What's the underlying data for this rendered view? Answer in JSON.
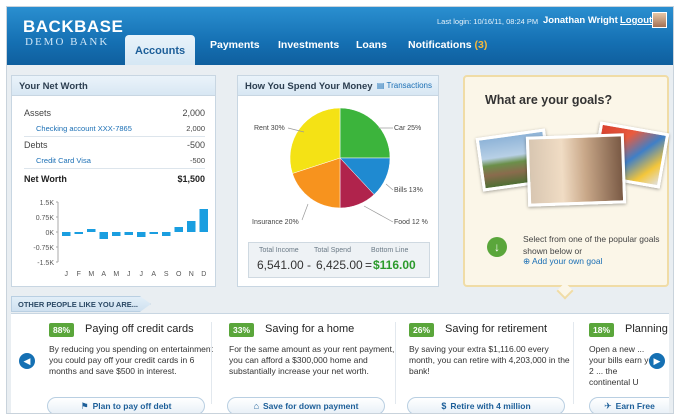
{
  "header": {
    "logo_title": "BACKBASE",
    "logo_subtitle": "DEMO BANK",
    "last_login": "Last login: 10/16/11, 08:24 PM",
    "user_name": "Jonathan Wright",
    "logout": "Logout",
    "tabs": [
      {
        "label": "Accounts",
        "active": true
      },
      {
        "label": "Payments"
      },
      {
        "label": "Investments"
      },
      {
        "label": "Loans"
      },
      {
        "label": "Notifications",
        "count": "(3)"
      }
    ]
  },
  "net_worth": {
    "title": "Your Net Worth",
    "assets_label": "Assets",
    "assets_value": "2,000",
    "checking_label": "Checking account XXX-7865",
    "checking_value": "2,000",
    "debts_label": "Debts",
    "debts_value": "-500",
    "card_label": "Credit Card Visa",
    "card_value": "-500",
    "total_label": "Net Worth",
    "total_value": "$1,500",
    "chart": {
      "y_ticks": [
        "1.5K",
        "0.75K",
        "0K",
        "-0.75K",
        "-1.5K"
      ],
      "months": [
        "J",
        "F",
        "M",
        "A",
        "M",
        "J",
        "J",
        "A",
        "S",
        "O",
        "N",
        "D"
      ],
      "values": [
        -0.2,
        -0.1,
        0.15,
        -0.35,
        -0.2,
        -0.15,
        -0.25,
        -0.1,
        -0.2,
        0.25,
        0.55,
        1.15
      ],
      "bar_color": "#1a9ee0"
    }
  },
  "spend": {
    "title": "How You Spend Your Money",
    "link": "Transactions",
    "slices": [
      {
        "label": "Rent 30%",
        "value": 30,
        "color": "#3cb43c"
      },
      {
        "label": "Car 25%",
        "value": 25,
        "color": "#3cb43c"
      },
      {
        "label": "Bills 13%",
        "value": 13,
        "color": "#1f8ad1"
      },
      {
        "label": "Food 12 %",
        "value": 12,
        "color": "#b0234c"
      },
      {
        "label": "Insurance 20%",
        "value": 20,
        "color": "#f7931e"
      }
    ],
    "pie_colors": {
      "rent": "#f4e215",
      "car": "#3cb43c",
      "bills": "#1f8ad1",
      "food": "#b0234c",
      "insurance": "#f7931e"
    },
    "total_income_label": "Total Income",
    "total_spend_label": "Total Spend",
    "bottom_line_label": "Bottom Line",
    "total_income": "6,541.00",
    "minus": "-",
    "total_spend": "6,425.00",
    "equals": "=",
    "bottom_line": "$116.00"
  },
  "goals": {
    "title": "What are your goals?",
    "description": "Select from one of the popular goals shown below or",
    "add_link": "Add your own goal"
  },
  "others": {
    "label": "OTHER PEOPLE LIKE YOU ARE...",
    "cards": [
      {
        "badge": "88%",
        "title": "Paying off credit cards",
        "text": "By reducing you spending on entertainment you could pay off your credit cards in 6 months and save $500 in interest.",
        "button": "Plan to pay off debt",
        "icon": "⚑"
      },
      {
        "badge": "33%",
        "title": "Saving for a home",
        "text": "For the same amount as your rent payment, you can afford a $300,000 home and substantially increase your net worth.",
        "button": "Save for down payment",
        "icon": "⌂"
      },
      {
        "badge": "26%",
        "title": "Saving for retirement",
        "text": "By saving your extra $1,116.00 every month, you can retire with 4,203,000 in the bank!",
        "button": "Retire with 4 million",
        "icon": "$"
      },
      {
        "badge": "18%",
        "title": "Planning",
        "text": "Open a new ... your bills earn you 2 ... the continental U",
        "button": "Earn Free",
        "icon": "✈"
      }
    ]
  }
}
